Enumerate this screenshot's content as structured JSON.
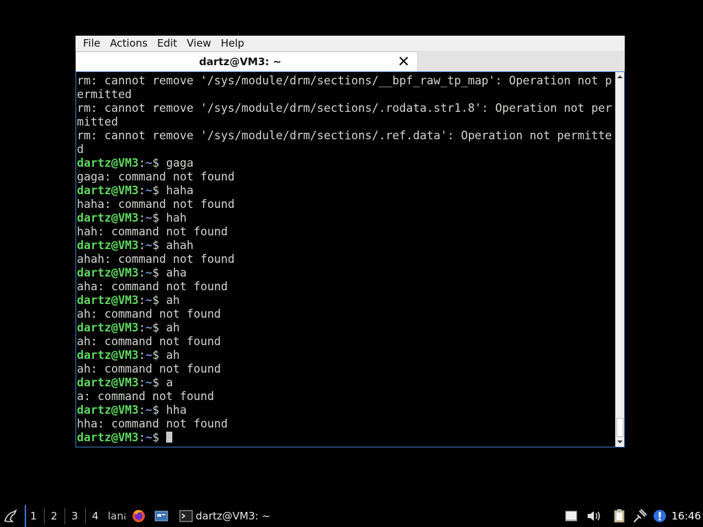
{
  "window": {
    "menu": [
      "File",
      "Actions",
      "Edit",
      "View",
      "Help"
    ],
    "tab_title": "dartz@VM3: ~"
  },
  "terminal": {
    "prompt_user": "dartz@VM3",
    "prompt_colon": ":",
    "prompt_path": "~",
    "prompt_symbol": "$ ",
    "rows": [
      {
        "type": "out",
        "text": "rm: cannot remove '/sys/module/drm/sections/__bpf_raw_tp_map': Operation not p"
      },
      {
        "type": "out",
        "text": "ermitted"
      },
      {
        "type": "out",
        "text": "rm: cannot remove '/sys/module/drm/sections/.rodata.str1.8': Operation not per"
      },
      {
        "type": "out",
        "text": "mitted"
      },
      {
        "type": "out",
        "text": "rm: cannot remove '/sys/module/drm/sections/.ref.data': Operation not permitte"
      },
      {
        "type": "out",
        "text": "d"
      },
      {
        "type": "cmd",
        "text": "gaga"
      },
      {
        "type": "out",
        "text": "gaga: command not found"
      },
      {
        "type": "cmd",
        "text": "haha"
      },
      {
        "type": "out",
        "text": "haha: command not found"
      },
      {
        "type": "cmd",
        "text": "hah"
      },
      {
        "type": "out",
        "text": "hah: command not found"
      },
      {
        "type": "cmd",
        "text": "ahah"
      },
      {
        "type": "out",
        "text": "ahah: command not found"
      },
      {
        "type": "cmd",
        "text": "aha"
      },
      {
        "type": "out",
        "text": "aha: command not found"
      },
      {
        "type": "cmd",
        "text": "ah"
      },
      {
        "type": "out",
        "text": "ah: command not found"
      },
      {
        "type": "cmd",
        "text": "ah"
      },
      {
        "type": "out",
        "text": "ah: command not found"
      },
      {
        "type": "cmd",
        "text": "ah"
      },
      {
        "type": "out",
        "text": "ah: command not found"
      },
      {
        "type": "cmd",
        "text": "a"
      },
      {
        "type": "out",
        "text": "a: command not found"
      },
      {
        "type": "cmd",
        "text": "hha"
      },
      {
        "type": "out",
        "text": "hha: command not found"
      },
      {
        "type": "cmd",
        "text": "",
        "cursor": true
      }
    ]
  },
  "taskbar": {
    "workspaces": [
      "1",
      "2",
      "3",
      "4"
    ],
    "truncated_label": "lana",
    "task_label": "dartz@VM3: ~",
    "clock": "16:46",
    "icons": [
      "start-menu-icon",
      "firefox-icon",
      "file-manager-icon",
      "terminal-icon",
      "notes-icon",
      "volume-icon",
      "clipboard-icon",
      "network-icon",
      "update-icon"
    ]
  },
  "colors": {
    "prompt": "#5fd75f",
    "path": "#6f8fd8",
    "text": "#d3d7cf",
    "accent": "#3b7bd8"
  }
}
